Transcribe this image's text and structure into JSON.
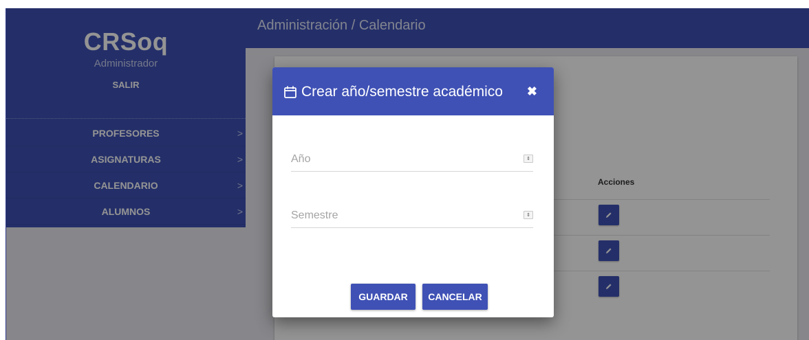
{
  "app": {
    "brand": "CRSoq",
    "role": "Administrador",
    "logout_label": "SALIR"
  },
  "sidebar": {
    "items": [
      {
        "label": "PROFESORES",
        "chevron": ">"
      },
      {
        "label": "ASIGNATURAS",
        "chevron": ">"
      },
      {
        "label": "CALENDARIO",
        "chevron": ">"
      },
      {
        "label": "ALUMNOS",
        "chevron": ">"
      }
    ]
  },
  "header": {
    "breadcrumb": "Administración / Calendario"
  },
  "table": {
    "actions_header": "Acciones",
    "row_count": 3
  },
  "modal": {
    "title": "Crear año/semestre académico",
    "close_symbol": "✖",
    "fields": [
      {
        "placeholder": "Año",
        "value": ""
      },
      {
        "placeholder": "Semestre",
        "value": ""
      }
    ],
    "save_label": "GUARDAR",
    "cancel_label": "CANCELAR"
  },
  "colors": {
    "primary": "#3f51b5",
    "overlay": "rgba(0,0,0,0.42)"
  },
  "icons": {
    "modal_title_icon": "calendar-icon",
    "row_action_icon": "pencil-icon",
    "close_icon": "close-icon",
    "nav_chevron": "chevron-right-icon",
    "number_spinner": "spinner-icon"
  }
}
